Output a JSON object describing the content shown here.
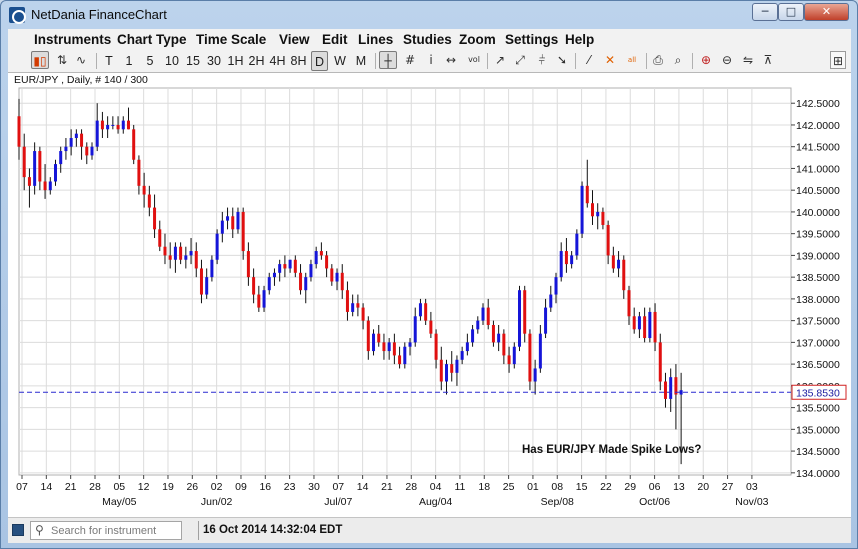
{
  "window": {
    "title": "NetDania FinanceChart",
    "controls": [
      "─",
      "□",
      "✕"
    ]
  },
  "menu": [
    "Instruments",
    "Chart Type",
    "Time Scale",
    "View",
    "Edit",
    "Lines",
    "Studies",
    "Zoom",
    "Settings",
    "Help"
  ],
  "timescale": {
    "buttons": [
      "T",
      "1",
      "5",
      "10",
      "15",
      "30",
      "1H",
      "2H",
      "4H",
      "8H",
      "D",
      "W",
      "M"
    ],
    "selected": "D"
  },
  "tool_icons": [
    "bar-chart-icon",
    "line-chart-icon",
    "crosshair-icon",
    "grid-icon",
    "info-icon",
    "arrows-icon",
    "volume-icon",
    "trendline-icon",
    "fibonacci-icon",
    "delete-icon",
    "delete-all-icon",
    "print-icon",
    "preview-icon",
    "zoom-in-icon",
    "zoom-out-icon",
    "fit-icon",
    "settings-icon"
  ],
  "toolbar_text": {
    "info": "i",
    "vol": "vol",
    "all": "all"
  },
  "status": {
    "search_placeholder": "Search for instrument",
    "datetime": "16 Oct 2014 14:32:04 EDT"
  },
  "colors": {
    "up": "#1515d8",
    "down": "#e01010",
    "wick": "#111111",
    "current_line": "#2a2ad0",
    "grid": "#dcdcdc"
  },
  "chart_data": {
    "type": "candlestick",
    "instrument_label": "EUR/JPY , Daily, # 140 / 300",
    "annotation": "Has EUR/JPY Made Spike Lows?",
    "current_price": 135.853,
    "current_price_label": "135.8530",
    "ylim": [
      133.95,
      142.85
    ],
    "y_ticks": [
      "142.5000",
      "142.0000",
      "141.5000",
      "141.0000",
      "140.5000",
      "140.0000",
      "139.5000",
      "139.0000",
      "138.5000",
      "138.0000",
      "137.5000",
      "137.0000",
      "136.5000",
      "136.0000",
      "135.5000",
      "135.0000",
      "134.5000",
      "134.0000"
    ],
    "x_ticks": [
      "07",
      "14",
      "21",
      "28",
      "05",
      "12",
      "19",
      "26",
      "02",
      "09",
      "16",
      "23",
      "30",
      "07",
      "14",
      "21",
      "28",
      "04",
      "11",
      "18",
      "25",
      "01",
      "08",
      "15",
      "22",
      "29",
      "06",
      "13",
      "20",
      "27",
      "03"
    ],
    "x_months": [
      {
        "label": "May/05",
        "tick": 4
      },
      {
        "label": "Jun/02",
        "tick": 8
      },
      {
        "label": "Jul/07",
        "tick": 13
      },
      {
        "label": "Aug/04",
        "tick": 17
      },
      {
        "label": "Sep/08",
        "tick": 22
      },
      {
        "label": "Oct/06",
        "tick": 26
      },
      {
        "label": "Nov/03",
        "tick": 30
      }
    ],
    "series_days": 140,
    "ohlc": [
      [
        142.2,
        142.6,
        141.2,
        141.5
      ],
      [
        141.5,
        141.8,
        140.5,
        140.8
      ],
      [
        140.8,
        141.0,
        140.1,
        140.6
      ],
      [
        140.6,
        141.6,
        140.4,
        141.4
      ],
      [
        141.4,
        141.5,
        140.5,
        140.7
      ],
      [
        140.7,
        141.1,
        140.3,
        140.5
      ],
      [
        140.5,
        140.8,
        140.4,
        140.7
      ],
      [
        140.7,
        141.2,
        140.6,
        141.1
      ],
      [
        141.1,
        141.5,
        140.9,
        141.4
      ],
      [
        141.4,
        141.7,
        141.2,
        141.5
      ],
      [
        141.5,
        141.9,
        141.3,
        141.7
      ],
      [
        141.7,
        141.9,
        141.5,
        141.8
      ],
      [
        141.8,
        141.9,
        141.2,
        141.5
      ],
      [
        141.5,
        141.6,
        141.1,
        141.3
      ],
      [
        141.3,
        141.6,
        141.2,
        141.5
      ],
      [
        141.5,
        142.5,
        141.4,
        142.1
      ],
      [
        142.1,
        142.3,
        141.7,
        141.9
      ],
      [
        141.9,
        142.2,
        141.7,
        142.0
      ],
      [
        142.0,
        142.2,
        141.9,
        142.0
      ],
      [
        142.0,
        142.2,
        141.8,
        141.9
      ],
      [
        141.9,
        142.2,
        141.8,
        142.1
      ],
      [
        142.1,
        142.4,
        141.9,
        141.9
      ],
      [
        141.9,
        142.0,
        141.1,
        141.2
      ],
      [
        141.2,
        141.3,
        140.4,
        140.6
      ],
      [
        140.6,
        140.9,
        140.1,
        140.4
      ],
      [
        140.4,
        140.6,
        139.9,
        140.1
      ],
      [
        140.1,
        140.4,
        139.4,
        139.6
      ],
      [
        139.6,
        139.8,
        139.1,
        139.2
      ],
      [
        139.2,
        139.5,
        138.8,
        139.0
      ],
      [
        139.0,
        139.3,
        138.7,
        138.9
      ],
      [
        138.9,
        139.3,
        138.6,
        139.2
      ],
      [
        139.2,
        139.3,
        138.8,
        138.9
      ],
      [
        138.9,
        139.2,
        138.7,
        139.0
      ],
      [
        139.0,
        139.4,
        138.8,
        139.1
      ],
      [
        139.1,
        139.3,
        138.5,
        138.7
      ],
      [
        138.7,
        138.9,
        137.9,
        138.1
      ],
      [
        138.1,
        138.7,
        138.0,
        138.5
      ],
      [
        138.5,
        139.0,
        138.4,
        138.9
      ],
      [
        138.9,
        139.6,
        138.8,
        139.5
      ],
      [
        139.5,
        140.0,
        139.3,
        139.8
      ],
      [
        139.8,
        140.1,
        139.6,
        139.9
      ],
      [
        139.9,
        140.1,
        139.4,
        139.6
      ],
      [
        139.6,
        140.1,
        139.5,
        140.0
      ],
      [
        140.0,
        140.1,
        138.9,
        139.1
      ],
      [
        139.1,
        139.3,
        138.3,
        138.5
      ],
      [
        138.5,
        138.7,
        137.9,
        138.1
      ],
      [
        138.1,
        138.3,
        137.7,
        137.8
      ],
      [
        137.8,
        138.3,
        137.7,
        138.2
      ],
      [
        138.2,
        138.6,
        138.1,
        138.5
      ],
      [
        138.5,
        138.7,
        138.3,
        138.6
      ],
      [
        138.6,
        138.9,
        138.4,
        138.8
      ],
      [
        138.8,
        139.0,
        138.5,
        138.7
      ],
      [
        138.7,
        138.9,
        138.6,
        138.9
      ],
      [
        138.9,
        139.0,
        138.5,
        138.6
      ],
      [
        138.6,
        138.8,
        138.1,
        138.2
      ],
      [
        138.2,
        138.6,
        137.9,
        138.5
      ],
      [
        138.5,
        138.9,
        138.4,
        138.8
      ],
      [
        138.8,
        139.2,
        138.7,
        139.1
      ],
      [
        139.1,
        139.3,
        138.9,
        139.0
      ],
      [
        139.0,
        139.1,
        138.5,
        138.7
      ],
      [
        138.7,
        138.8,
        138.3,
        138.4
      ],
      [
        138.4,
        138.7,
        138.2,
        138.6
      ],
      [
        138.6,
        138.8,
        138.0,
        138.2
      ],
      [
        138.2,
        138.4,
        137.5,
        137.7
      ],
      [
        137.7,
        138.1,
        137.6,
        137.9
      ],
      [
        137.9,
        138.1,
        137.6,
        137.8
      ],
      [
        137.8,
        137.9,
        137.3,
        137.5
      ],
      [
        137.5,
        137.6,
        136.6,
        136.8
      ],
      [
        136.8,
        137.3,
        136.7,
        137.2
      ],
      [
        137.2,
        137.4,
        136.9,
        137.0
      ],
      [
        137.0,
        137.2,
        136.6,
        136.8
      ],
      [
        136.8,
        137.1,
        136.6,
        137.0
      ],
      [
        137.0,
        137.2,
        136.5,
        136.7
      ],
      [
        136.7,
        136.9,
        136.4,
        136.5
      ],
      [
        136.5,
        137.0,
        136.4,
        136.9
      ],
      [
        136.9,
        137.1,
        136.7,
        137.0
      ],
      [
        137.0,
        137.8,
        136.9,
        137.6
      ],
      [
        137.6,
        138.0,
        137.5,
        137.9
      ],
      [
        137.9,
        138.0,
        137.4,
        137.5
      ],
      [
        137.5,
        137.7,
        137.1,
        137.2
      ],
      [
        137.2,
        137.3,
        136.4,
        136.6
      ],
      [
        136.6,
        136.9,
        135.9,
        136.1
      ],
      [
        136.1,
        136.6,
        135.8,
        136.5
      ],
      [
        136.5,
        136.8,
        136.1,
        136.3
      ],
      [
        136.3,
        136.7,
        136.0,
        136.6
      ],
      [
        136.6,
        136.9,
        136.5,
        136.8
      ],
      [
        136.8,
        137.2,
        136.7,
        137.0
      ],
      [
        137.0,
        137.4,
        136.9,
        137.3
      ],
      [
        137.3,
        137.6,
        137.2,
        137.5
      ],
      [
        137.5,
        137.9,
        137.4,
        137.8
      ],
      [
        137.8,
        138.0,
        137.3,
        137.4
      ],
      [
        137.4,
        137.5,
        136.9,
        137.0
      ],
      [
        137.0,
        137.4,
        136.8,
        137.2
      ],
      [
        137.2,
        137.3,
        136.5,
        136.7
      ],
      [
        136.7,
        136.9,
        136.3,
        136.5
      ],
      [
        136.5,
        137.0,
        136.4,
        136.9
      ],
      [
        136.9,
        138.3,
        136.8,
        138.2
      ],
      [
        138.2,
        138.3,
        137.0,
        137.2
      ],
      [
        137.2,
        137.3,
        135.9,
        136.1
      ],
      [
        136.1,
        136.6,
        135.8,
        136.4
      ],
      [
        136.4,
        137.4,
        136.3,
        137.2
      ],
      [
        137.2,
        138.0,
        137.1,
        137.8
      ],
      [
        137.8,
        138.3,
        137.7,
        138.1
      ],
      [
        138.1,
        138.6,
        137.9,
        138.5
      ],
      [
        138.5,
        139.3,
        138.4,
        139.1
      ],
      [
        139.1,
        139.4,
        138.6,
        138.8
      ],
      [
        138.8,
        139.1,
        138.7,
        139.0
      ],
      [
        139.0,
        139.6,
        138.9,
        139.5
      ],
      [
        139.5,
        140.7,
        139.4,
        140.6
      ],
      [
        140.6,
        141.2,
        140.1,
        140.2
      ],
      [
        140.2,
        140.5,
        139.7,
        139.9
      ],
      [
        139.9,
        140.2,
        139.6,
        140.0
      ],
      [
        140.0,
        140.1,
        139.6,
        139.7
      ],
      [
        139.7,
        139.8,
        138.8,
        139.0
      ],
      [
        139.0,
        139.2,
        138.6,
        138.7
      ],
      [
        138.7,
        139.1,
        138.5,
        138.9
      ],
      [
        138.9,
        139.0,
        138.0,
        138.2
      ],
      [
        138.2,
        138.3,
        137.4,
        137.6
      ],
      [
        137.6,
        137.8,
        137.2,
        137.3
      ],
      [
        137.3,
        137.7,
        137.1,
        137.6
      ],
      [
        137.6,
        137.8,
        137.0,
        137.1
      ],
      [
        137.1,
        137.8,
        137.0,
        137.7
      ],
      [
        137.7,
        137.9,
        136.8,
        137.0
      ],
      [
        137.0,
        137.2,
        135.9,
        136.1
      ],
      [
        136.1,
        136.3,
        135.5,
        135.7
      ],
      [
        135.7,
        136.4,
        135.4,
        136.2
      ],
      [
        136.2,
        136.5,
        135.0,
        135.8
      ],
      [
        135.8,
        136.3,
        134.2,
        135.9
      ]
    ]
  }
}
